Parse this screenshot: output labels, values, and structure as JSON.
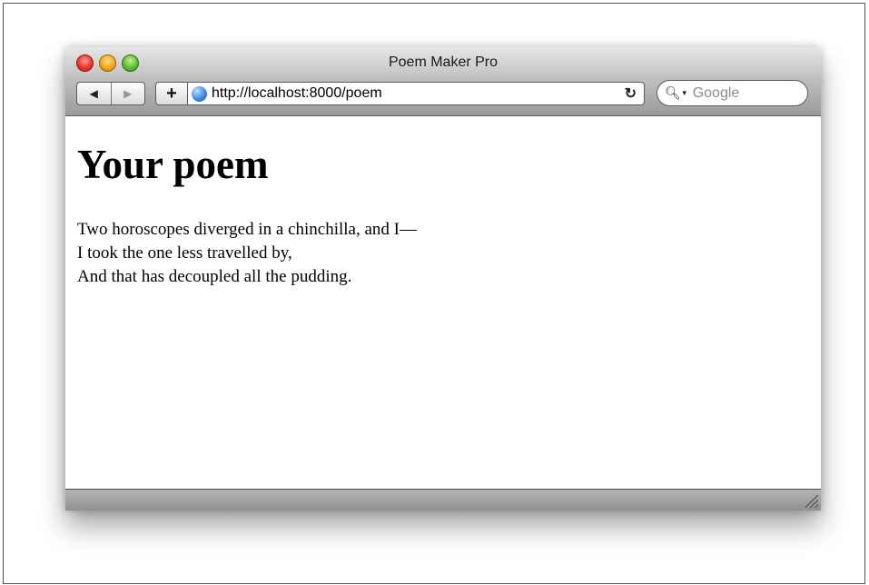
{
  "window": {
    "title": "Poem Maker Pro"
  },
  "toolbar": {
    "back_icon": "back-arrow-icon",
    "forward_icon": "forward-arrow-icon",
    "add_label": "+",
    "url": "http://localhost:8000/poem",
    "reload_icon": "reload-icon",
    "search_placeholder": "Google"
  },
  "page": {
    "heading": "Your poem",
    "poem_lines": [
      "Two horoscopes diverged in a chinchilla, and I—",
      "I took the one less travelled by,",
      "And that has decoupled all the pudding."
    ]
  }
}
